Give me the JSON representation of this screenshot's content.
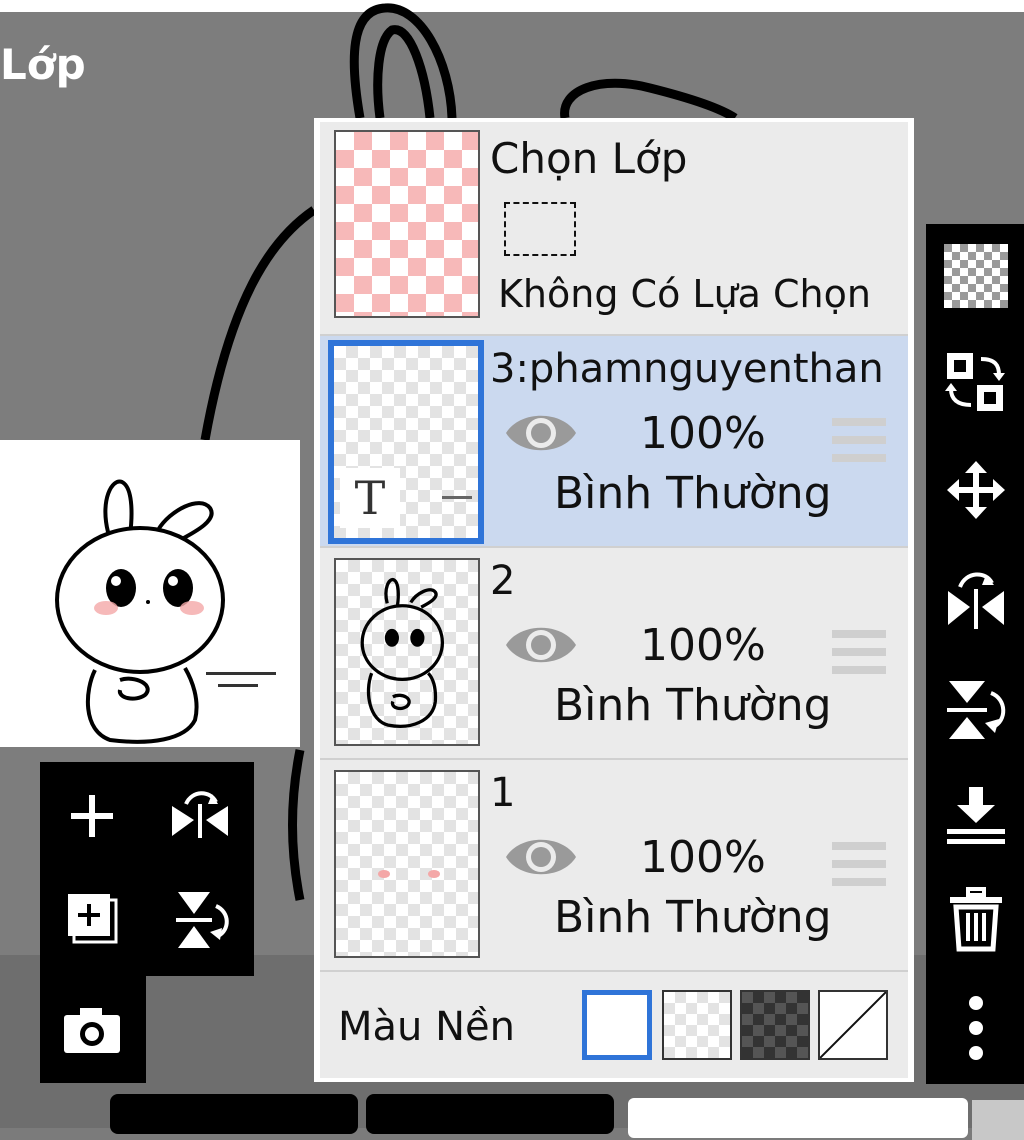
{
  "screen": {
    "title": "Lớp"
  },
  "selection": {
    "title": "Chọn Lớp",
    "status": "Không Có Lựa Chọn"
  },
  "layers": [
    {
      "name": "3:phamnguyenthan",
      "opacity": "100%",
      "blend": "Bình Thường",
      "visible": true,
      "active": true,
      "text_icon": "T"
    },
    {
      "name": "2",
      "opacity": "100%",
      "blend": "Bình Thường",
      "visible": true,
      "active": false
    },
    {
      "name": "1",
      "opacity": "100%",
      "blend": "Bình Thường",
      "visible": true,
      "active": false
    }
  ],
  "background": {
    "label": "Màu Nền",
    "options": [
      "white",
      "transparent",
      "dark-checker",
      "none"
    ],
    "selected": "white"
  },
  "left_tools": [
    "add-layer-icon",
    "flip-horizontal-icon",
    "copy-layer-icon",
    "flip-vertical-icon",
    "camera-icon"
  ],
  "right_tools": [
    "transparency-icon",
    "swap-layers-icon",
    "move-icon",
    "flip-horizontal-icon",
    "flip-vertical-icon",
    "merge-down-icon",
    "trash-icon",
    "more-options-icon"
  ],
  "colors": {
    "accent": "#2f74d8",
    "active_row": "#cbd9ef",
    "panel_bg": "#ebebeb",
    "pink_checker": "#f7b9b9"
  }
}
